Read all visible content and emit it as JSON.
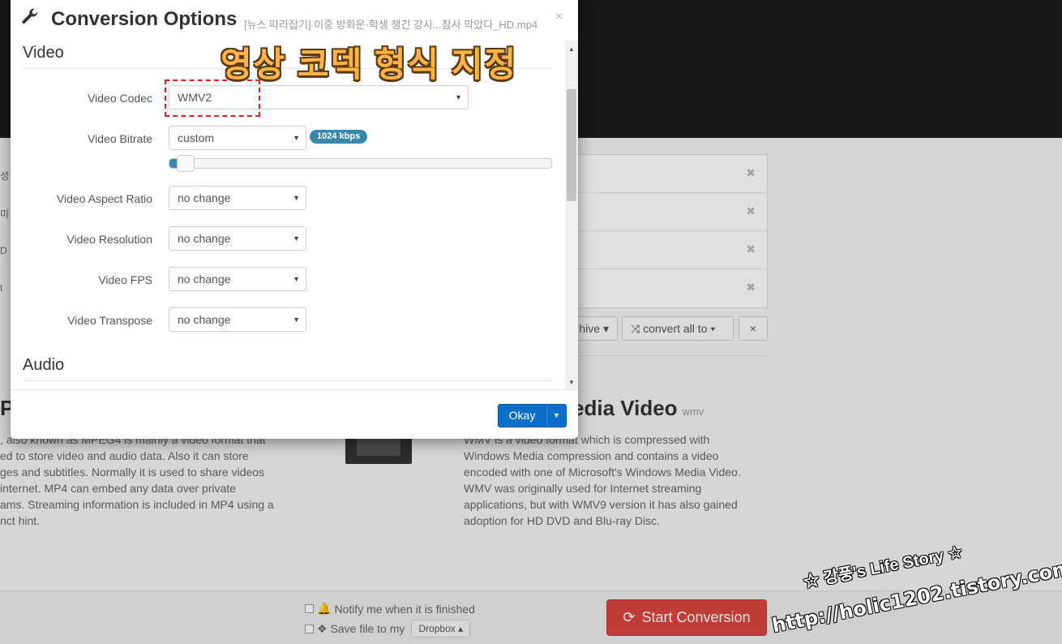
{
  "background": {
    "left_labels": [
      "성",
      "미",
      "D",
      "t"
    ],
    "list_rows": 4,
    "archive_label": "hive",
    "convert_all_label": "convert all to",
    "close_label": "×",
    "format_title": "edia Video",
    "format_ext": "wmv",
    "left_heading": "P",
    "left_desc": [
      ", also known as MPEG4 is mainly a video format that",
      "ed to store video and audio data. Also it can store",
      "ges and subtitles. Normally it is used to share videos",
      " internet. MP4 can embed any data over private",
      "ams. Streaming information is included in MP4 using a",
      "nct hint."
    ],
    "right_desc": [
      "WMV is a video format which is compressed with",
      "Windows Media compression and contains a video",
      "encoded with one of Microsoft's Windows Media Video.",
      "WMV was originally used for Internet streaming",
      "applications, but with WMV9 version it has also gained",
      "adoption for HD DVD and Blu-ray Disc."
    ],
    "notify_label": "Notify me when it is finished",
    "save_label": "Save file to my",
    "dropbox_label": "Dropbox",
    "start_label": "Start Conversion"
  },
  "modal": {
    "title": "Conversion Options",
    "filename": "[뉴스 따라잡기] 이중 방화문·학생 챙긴 강사...참사 막았다_HD.mp4",
    "close": "×",
    "video_section": "Video",
    "audio_section": "Audio",
    "fields": {
      "codec": {
        "label": "Video Codec",
        "value": "WMV2"
      },
      "bitrate": {
        "label": "Video Bitrate",
        "value": "custom",
        "badge": "1024 kbps",
        "slider_fraction": 0.02
      },
      "aspect": {
        "label": "Video Aspect Ratio",
        "value": "no change"
      },
      "resolution": {
        "label": "Video Resolution",
        "value": "no change"
      },
      "fps": {
        "label": "Video FPS",
        "value": "no change"
      },
      "transpose": {
        "label": "Video Transpose",
        "value": "no change"
      }
    },
    "okay_label": "Okay"
  },
  "overlay": {
    "annotation": "영상 코덱 형식 지정",
    "watermark_line1": "☆ 강풍's Life Story ☆",
    "watermark_line2": "http://holic1202.tistory.com"
  }
}
